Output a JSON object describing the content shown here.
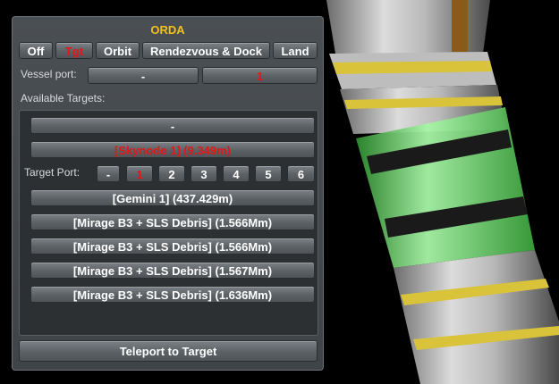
{
  "window": {
    "title": "ORDA"
  },
  "modes": [
    "Off",
    "Tgt",
    "Orbit",
    "Rendezvous & Dock",
    "Land"
  ],
  "vessel_port": {
    "label": "Vessel port:",
    "prev": "-",
    "value": "1"
  },
  "targets": {
    "label": "Available Targets:",
    "none": "-",
    "selected": "[Skynode 1] (9.349m)",
    "port_label": "Target Port:",
    "ports": [
      "-",
      "1",
      "2",
      "3",
      "4",
      "5",
      "6"
    ],
    "others": [
      "[Gemini 1] (437.429m)",
      "[Mirage B3 + SLS Debris] (1.566Mm)",
      "[Mirage B3 + SLS Debris] (1.566Mm)",
      "[Mirage B3 + SLS Debris] (1.567Mm)",
      "[Mirage B3 + SLS Debris] (1.636Mm)"
    ]
  },
  "teleport_label": "Teleport to Target",
  "colors": {
    "title": "#f0c020",
    "active": "#e01818",
    "text": "#ffffff"
  }
}
